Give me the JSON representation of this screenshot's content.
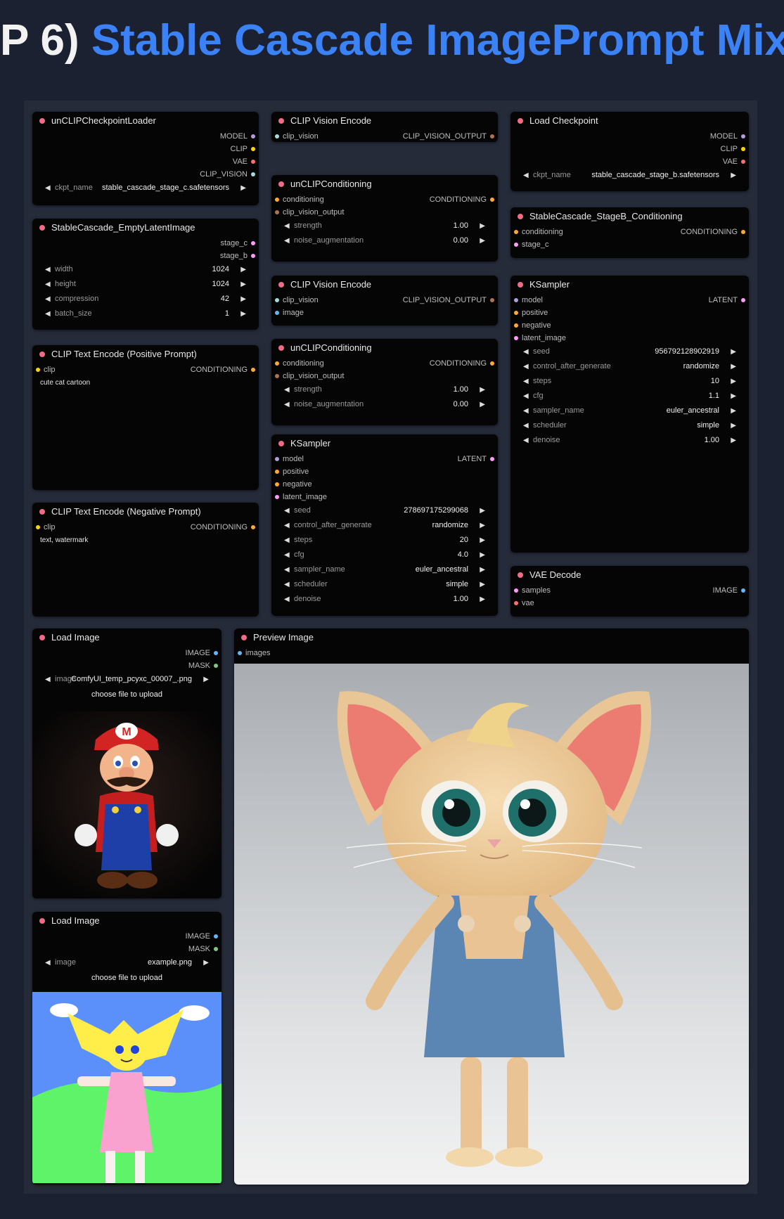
{
  "heading": {
    "prefix": "P 6)",
    "title": "Stable Cascade ImagePrompt Mix"
  },
  "nodes": {
    "unclip_loader": {
      "title": "unCLIPCheckpointLoader",
      "outputs": [
        "MODEL",
        "CLIP",
        "VAE",
        "CLIP_VISION"
      ],
      "widget_name": "ckpt_name",
      "widget_value": "stable_cascade_stage_c.safetensors"
    },
    "empty_latent": {
      "title": "StableCascade_EmptyLatentImage",
      "outputs": [
        "stage_c",
        "stage_b"
      ],
      "widgets": [
        {
          "name": "width",
          "value": "1024"
        },
        {
          "name": "height",
          "value": "1024"
        },
        {
          "name": "compression",
          "value": "42"
        },
        {
          "name": "batch_size",
          "value": "1"
        }
      ]
    },
    "clip_pos": {
      "title": "CLIP Text Encode (Positive Prompt)",
      "input": "clip",
      "output": "CONDITIONING",
      "text": "cute cat cartoon"
    },
    "clip_neg": {
      "title": "CLIP Text Encode (Negative Prompt)",
      "input": "clip",
      "output": "CONDITIONING",
      "text": "text, watermark"
    },
    "cve1": {
      "title": "CLIP Vision Encode",
      "inputs": [
        "clip_vision",
        "image"
      ],
      "output": "CLIP_VISION_OUTPUT"
    },
    "unclip_cond1": {
      "title": "unCLIPConditioning",
      "inputs": [
        "conditioning",
        "clip_vision_output"
      ],
      "output": "CONDITIONING",
      "widgets": [
        {
          "name": "strength",
          "value": "1.00"
        },
        {
          "name": "noise_augmentation",
          "value": "0.00"
        }
      ]
    },
    "cve2": {
      "title": "CLIP Vision Encode",
      "inputs": [
        "clip_vision",
        "image"
      ],
      "output": "CLIP_VISION_OUTPUT"
    },
    "unclip_cond2": {
      "title": "unCLIPConditioning",
      "inputs": [
        "conditioning",
        "clip_vision_output"
      ],
      "output": "CONDITIONING",
      "widgets": [
        {
          "name": "strength",
          "value": "1.00"
        },
        {
          "name": "noise_augmentation",
          "value": "0.00"
        }
      ]
    },
    "ksampler_mid": {
      "title": "KSampler",
      "inputs": [
        "model",
        "positive",
        "negative",
        "latent_image"
      ],
      "output": "LATENT",
      "widgets": [
        {
          "name": "seed",
          "value": "278697175299068"
        },
        {
          "name": "control_after_generate",
          "value": "randomize"
        },
        {
          "name": "steps",
          "value": "20"
        },
        {
          "name": "cfg",
          "value": "4.0"
        },
        {
          "name": "sampler_name",
          "value": "euler_ancestral"
        },
        {
          "name": "scheduler",
          "value": "simple"
        },
        {
          "name": "denoise",
          "value": "1.00"
        }
      ]
    },
    "load_ckpt": {
      "title": "Load Checkpoint",
      "outputs": [
        "MODEL",
        "CLIP",
        "VAE"
      ],
      "widget_name": "ckpt_name",
      "widget_value": "stable_cascade_stage_b.safetensors"
    },
    "stageb_cond": {
      "title": "StableCascade_StageB_Conditioning",
      "inputs": [
        "conditioning",
        "stage_c"
      ],
      "output": "CONDITIONING"
    },
    "ksampler_right": {
      "title": "KSampler",
      "inputs": [
        "model",
        "positive",
        "negative",
        "latent_image"
      ],
      "output": "LATENT",
      "widgets": [
        {
          "name": "seed",
          "value": "956792128902919"
        },
        {
          "name": "control_after_generate",
          "value": "randomize"
        },
        {
          "name": "steps",
          "value": "10"
        },
        {
          "name": "cfg",
          "value": "1.1"
        },
        {
          "name": "sampler_name",
          "value": "euler_ancestral"
        },
        {
          "name": "scheduler",
          "value": "simple"
        },
        {
          "name": "denoise",
          "value": "1.00"
        }
      ]
    },
    "vae_decode": {
      "title": "VAE Decode",
      "inputs": [
        "samples",
        "vae"
      ],
      "output": "IMAGE"
    },
    "load_image1": {
      "title": "Load Image",
      "outputs": [
        "IMAGE",
        "MASK"
      ],
      "widget_name": "image",
      "widget_value": "ComfyUI_temp_pcyxc_00007_.png",
      "upload": "choose file to upload"
    },
    "load_image2": {
      "title": "Load Image",
      "outputs": [
        "IMAGE",
        "MASK"
      ],
      "widget_name": "image",
      "widget_value": "example.png",
      "upload": "choose file to upload"
    },
    "preview": {
      "title": "Preview Image",
      "input": "images"
    }
  }
}
